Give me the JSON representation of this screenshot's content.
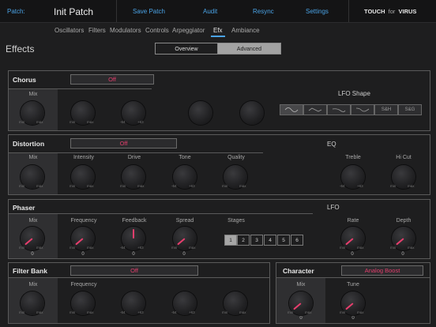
{
  "topbar": {
    "patch_label": "Patch:",
    "patch_name": "Init Patch",
    "save_patch": "Save Patch",
    "audit": "Audit",
    "resync": "Resync",
    "settings": "Settings",
    "brand_touch": "TOUCH",
    "brand_for": "for",
    "brand_virus": "VIRUS"
  },
  "subtabs": [
    "Oscillators",
    "Filters",
    "Modulators",
    "Controls",
    "Arpeggiator",
    "Efx",
    "Ambiance"
  ],
  "page_title": "Effects",
  "view_toggle": {
    "overview": "Overview",
    "advanced": "Advanced"
  },
  "chorus": {
    "title": "Chorus",
    "value": "Off",
    "mix_label": "Mix",
    "lfo_shape_label": "LFO Shape",
    "shapes": [
      "sine-icon",
      "triangle-icon",
      "saw-icon",
      "square-icon",
      "S&H",
      "S&G"
    ]
  },
  "distortion": {
    "title": "Distortion",
    "value": "Off",
    "labels": [
      "Mix",
      "Intensity",
      "Drive",
      "Tone",
      "Quality"
    ],
    "eq_title": "EQ",
    "eq_labels": [
      "Treble",
      "Hi Cut"
    ]
  },
  "phaser": {
    "title": "Phaser",
    "labels": [
      "Mix",
      "Frequency",
      "Feedback",
      "Spread"
    ],
    "values": [
      "0",
      "0",
      "0",
      "0"
    ],
    "stages_label": "Stages",
    "stages": [
      "1",
      "2",
      "3",
      "4",
      "5",
      "6"
    ],
    "lfo_title": "LFO",
    "lfo_labels": [
      "Rate",
      "Depth"
    ],
    "lfo_values": [
      "0",
      "0"
    ]
  },
  "filter_bank": {
    "title": "Filter Bank",
    "value": "Off",
    "labels": [
      "Mix",
      "Frequency"
    ]
  },
  "character": {
    "title": "Character",
    "value": "Analog Boost",
    "labels": [
      "Mix",
      "Tune"
    ],
    "values": [
      "0",
      "0"
    ]
  },
  "knob_scale": {
    "min": "min",
    "max": "max",
    "neg": "-64",
    "pos": "+63"
  }
}
